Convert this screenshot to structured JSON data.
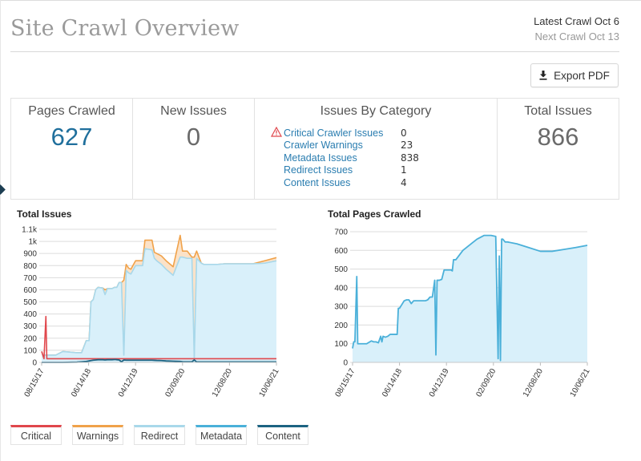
{
  "page": {
    "title": "Site Crawl Overview",
    "latest_crawl": "Latest Crawl Oct 6",
    "next_crawl": "Next Crawl Oct 13",
    "export_button": {
      "label": "Export PDF",
      "icon": "download-icon"
    }
  },
  "summary": {
    "pages_crawled": {
      "title": "Pages Crawled",
      "value": "627"
    },
    "new_issues": {
      "title": "New Issues",
      "value": "0"
    },
    "issues_by_category": {
      "title": "Issues By Category",
      "items": [
        {
          "label": "Critical Crawler Issues",
          "count": "0",
          "icon": "warning-triangle-icon"
        },
        {
          "label": "Crawler Warnings",
          "count": "23"
        },
        {
          "label": "Metadata Issues",
          "count": "838"
        },
        {
          "label": "Redirect Issues",
          "count": "1"
        },
        {
          "label": "Content Issues",
          "count": "4"
        }
      ]
    },
    "total_issues": {
      "title": "Total Issues",
      "value": "866"
    }
  },
  "colors": {
    "critical": "#e0474c",
    "warnings": "#f0a24a",
    "redirect": "#a9d8ea",
    "metadata": "#4ab0d9",
    "content": "#1c6382",
    "area_fill": "#d9f0fa",
    "warning_fill": "#fbe2c8",
    "accent_blue": "#1f6f9c"
  },
  "legend": [
    {
      "label": "Critical",
      "key": "critical"
    },
    {
      "label": "Warnings",
      "key": "warnings"
    },
    {
      "label": "Redirect",
      "key": "redirect"
    },
    {
      "label": "Metadata",
      "key": "metadata"
    },
    {
      "label": "Content",
      "key": "content"
    }
  ],
  "chart_data": [
    {
      "type": "area",
      "title": "Total Issues",
      "xlabel": "",
      "ylabel": "",
      "x_tick_labels": [
        "08/15/17",
        "06/14/18",
        "04/12/19",
        "02/09/20",
        "12/08/20",
        "10/06/21"
      ],
      "y_tick_labels": [
        "0",
        "100",
        "200",
        "300",
        "400",
        "500",
        "600",
        "700",
        "800",
        "900",
        "1k",
        "1.1k"
      ],
      "ylim": [
        0,
        1100
      ],
      "xlim": [
        0,
        100
      ],
      "grid": true,
      "legend_position": "bottom",
      "x": [
        0,
        0.5,
        1,
        1.8,
        2.2,
        2.6,
        3,
        6,
        9,
        15,
        17,
        19,
        19.6,
        20.2,
        21,
        22,
        23,
        24,
        26,
        27,
        28,
        30,
        31,
        31.5,
        32,
        33,
        34,
        35,
        36,
        37,
        38,
        40,
        41,
        43,
        44,
        47,
        48,
        49,
        51,
        53,
        56,
        59,
        60,
        62,
        64,
        65,
        66,
        68,
        69,
        70,
        71,
        73,
        75,
        78,
        80,
        85,
        90,
        95,
        100
      ],
      "series": [
        {
          "name": "Critical",
          "values": [
            90,
            60,
            30,
            380,
            30,
            30,
            30,
            30,
            30,
            30,
            30,
            30,
            30,
            30,
            30,
            30,
            30,
            30,
            30,
            30,
            30,
            30,
            30,
            30,
            30,
            30,
            30,
            30,
            30,
            30,
            30,
            30,
            30,
            30,
            30,
            30,
            30,
            30,
            30,
            30,
            30,
            30,
            30,
            30,
            30,
            30,
            30,
            30,
            30,
            30,
            30,
            30,
            30,
            30,
            30,
            30,
            30,
            30,
            30
          ]
        },
        {
          "name": "Warnings",
          "values": [
            90,
            60,
            60,
            60,
            60,
            60,
            60,
            60,
            90,
            80,
            80,
            180,
            180,
            180,
            500,
            520,
            600,
            620,
            615,
            600,
            610,
            610,
            620,
            620,
            620,
            660,
            660,
            680,
            810,
            780,
            770,
            840,
            840,
            840,
            1010,
            1010,
            910,
            900,
            880,
            840,
            790,
            1050,
            920,
            920,
            870,
            870,
            920,
            820,
            810,
            810,
            810,
            810,
            810,
            815,
            815,
            815,
            815,
            840,
            866
          ]
        },
        {
          "name": "Redirect",
          "values": [
            90,
            60,
            60,
            60,
            60,
            60,
            60,
            60,
            90,
            80,
            80,
            180,
            180,
            180,
            500,
            520,
            600,
            620,
            615,
            560,
            610,
            610,
            620,
            620,
            620,
            660,
            660,
            60,
            760,
            740,
            730,
            800,
            800,
            800,
            940,
            930,
            860,
            840,
            810,
            770,
            720,
            870,
            870,
            860,
            860,
            30,
            860,
            820,
            810,
            810,
            810,
            810,
            810,
            815,
            815,
            815,
            815,
            820,
            840
          ]
        },
        {
          "name": "Metadata",
          "values": [
            90,
            60,
            60,
            60,
            60,
            60,
            60,
            60,
            90,
            80,
            80,
            180,
            180,
            180,
            500,
            520,
            600,
            620,
            615,
            560,
            610,
            610,
            620,
            620,
            620,
            660,
            660,
            60,
            760,
            740,
            730,
            800,
            800,
            800,
            940,
            930,
            860,
            840,
            810,
            770,
            720,
            870,
            870,
            860,
            860,
            30,
            860,
            820,
            810,
            810,
            810,
            810,
            810,
            815,
            815,
            815,
            815,
            820,
            838
          ]
        },
        {
          "name": "Content",
          "values": [
            0,
            0,
            0,
            0,
            0,
            0,
            0,
            0,
            0,
            2,
            5,
            8,
            10,
            12,
            15,
            18,
            20,
            22,
            22,
            20,
            22,
            22,
            23,
            23,
            22,
            20,
            5,
            20,
            18,
            18,
            18,
            18,
            18,
            18,
            18,
            18,
            17,
            16,
            15,
            12,
            10,
            8,
            6,
            5,
            5,
            20,
            4,
            4,
            4,
            4,
            4,
            4,
            4,
            4,
            4,
            4,
            4,
            4,
            4
          ]
        }
      ]
    },
    {
      "type": "area",
      "title": "Total Pages Crawled",
      "xlabel": "",
      "ylabel": "",
      "x_tick_labels": [
        "08/15/17",
        "06/14/18",
        "04/12/19",
        "02/09/20",
        "12/08/20",
        "10/06/21"
      ],
      "y_tick_labels": [
        "0",
        "100",
        "200",
        "300",
        "400",
        "500",
        "600",
        "700"
      ],
      "ylim": [
        0,
        700
      ],
      "xlim": [
        0,
        100
      ],
      "grid": true,
      "x": [
        0,
        0.5,
        1,
        1.8,
        2.2,
        2.6,
        3,
        4,
        5,
        6,
        8,
        9,
        10,
        11,
        12,
        12.5,
        13,
        14,
        15,
        16,
        17,
        18,
        19,
        19.5,
        20,
        21,
        22,
        23,
        24,
        25,
        26,
        27,
        29,
        31,
        32,
        33,
        34,
        35,
        35.5,
        36,
        37,
        38,
        39,
        41,
        42,
        42.5,
        43,
        44,
        47,
        51,
        53,
        56,
        59,
        61,
        62,
        62.5,
        63,
        63.5,
        64,
        65,
        66,
        70,
        75,
        80,
        85,
        90,
        95,
        100
      ],
      "series": [
        {
          "name": "Pages Crawled",
          "values": [
            75,
            110,
            110,
            460,
            100,
            100,
            100,
            100,
            100,
            100,
            115,
            110,
            110,
            105,
            140,
            110,
            140,
            135,
            140,
            150,
            150,
            150,
            150,
            290,
            290,
            310,
            330,
            335,
            335,
            315,
            330,
            330,
            330,
            330,
            335,
            350,
            350,
            440,
            40,
            440,
            440,
            445,
            495,
            495,
            495,
            490,
            550,
            550,
            600,
            640,
            660,
            680,
            680,
            675,
            20,
            570,
            10,
            660,
            660,
            645,
            645,
            635,
            615,
            595,
            595,
            605,
            615,
            627
          ]
        }
      ]
    }
  ]
}
